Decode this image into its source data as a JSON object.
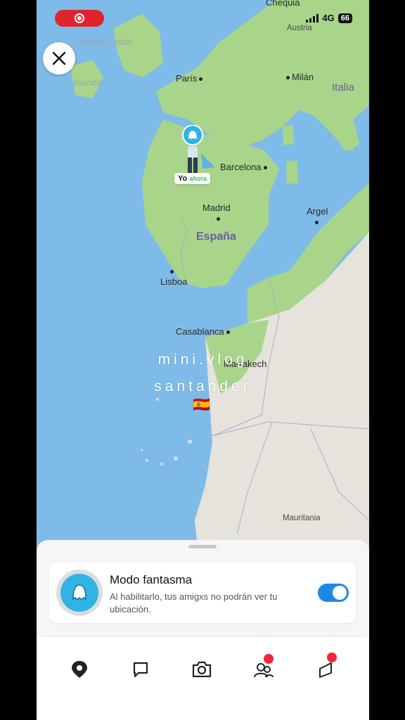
{
  "status_bar": {
    "network": "4G",
    "battery": "66",
    "recording_indicator": "screen-record-icon"
  },
  "map": {
    "labels": {
      "chequia": "Chequia",
      "austria": "Austria",
      "reino_unido": "Reino Unido",
      "irlanda": "Irlanda",
      "paris": "París",
      "milan": "Milán",
      "italia": "Italia",
      "barcelona": "Barcelona",
      "madrid": "Madrid",
      "espana": "España",
      "argel": "Argel",
      "lisboa": "Lisboa",
      "casablanca": "Casablanca",
      "marrakech": "Marrakech",
      "mauritania": "Mauritania"
    },
    "me_label": "Yo",
    "me_time": "ahora"
  },
  "overlay": {
    "line1": "mini.vlog",
    "line2": "santander",
    "flag": "🇪🇸"
  },
  "ghost_mode": {
    "title": "Modo fantasma",
    "description": "Al habilitarlo, tus amigxs no podrán ver tu ubicación.",
    "enabled": true
  },
  "nav": {
    "items": [
      "map-pin-icon",
      "chat-icon",
      "camera-icon",
      "friends-icon",
      "stories-icon"
    ],
    "badges": [
      "friends-icon",
      "stories-icon"
    ]
  },
  "colors": {
    "sea": "#7fbbe9",
    "land": "#a8d58a",
    "desert": "#e6e3dc",
    "accent": "#1e88e5",
    "badge": "#f2263a",
    "record": "#e0242c"
  }
}
